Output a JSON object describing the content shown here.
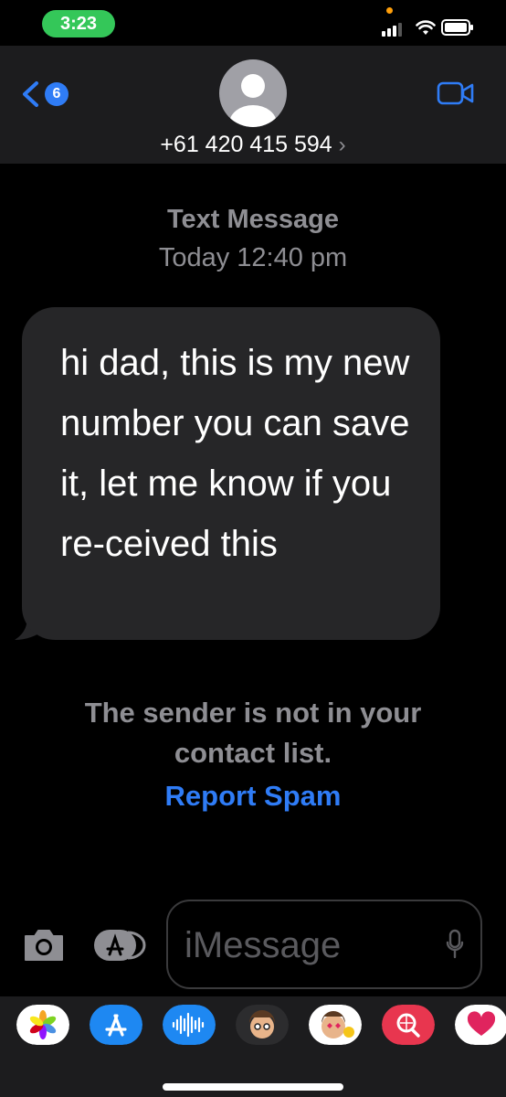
{
  "status_bar": {
    "time": "3:23"
  },
  "header": {
    "back_badge": "6",
    "contact_name": "+61 420 415 594",
    "contact_chevron": "›"
  },
  "conversation": {
    "service_label": "Text Message",
    "timestamp": "Today 12:40 pm",
    "messages": [
      {
        "direction": "incoming",
        "text": "hi dad, this is my new number you can save it, let me know if you re-ceived this"
      }
    ],
    "notice": "The sender is not in your contact list.",
    "report_spam_label": "Report Spam"
  },
  "composer": {
    "placeholder": "iMessage"
  },
  "app_drawer": {
    "apps": [
      "photos-icon",
      "app-store-icon",
      "audio-message-icon",
      "memoji-icon",
      "memoji-stickers-icon",
      "web-search-icon",
      "digital-touch-icon"
    ]
  },
  "colors": {
    "accent": "#2f7cf6",
    "status_green": "#34c759",
    "header_bg": "#1c1c1e",
    "bubble_bg": "#262628",
    "secondary_text": "#8e8e93"
  }
}
